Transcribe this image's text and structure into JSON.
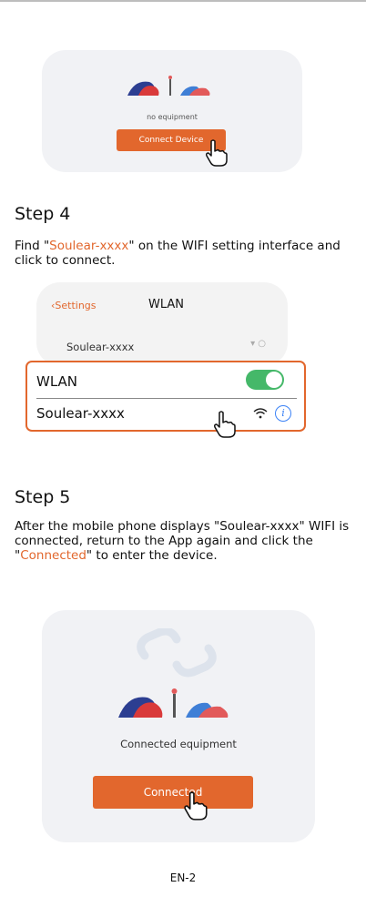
{
  "card1": {
    "no_equipment": "no equipment",
    "connect_button": "Connect Device"
  },
  "step4": {
    "title": "Step 4",
    "text": {
      "pre": "Find \"",
      "highlight": "Soulear-xxxx",
      "post": "\" on the WIFI setting interface and click to connect."
    }
  },
  "phone": {
    "back": "Settings",
    "title": "WLAN",
    "ssid": "Soulear-xxxx"
  },
  "wlan_box": {
    "wlan_label": "WLAN",
    "ssid_label": "Soulear-xxxx",
    "info": "i",
    "toggle_on": true
  },
  "step5": {
    "title": "Step 5",
    "text": {
      "pre": "After the mobile phone displays \"Soulear-xxxx\" WIFI is connected, return to the App again and click the \"",
      "highlight": "Connected",
      "post": "\" to enter the device."
    }
  },
  "card3": {
    "connected_equipment": "Connected equipment",
    "connected_button": "Connected"
  },
  "page_number": "EN-2",
  "colors": {
    "accent": "#e2672d",
    "toggle": "#45b869",
    "info": "#3b82f6"
  },
  "icons": [
    "hand-pointer-icon",
    "wifi-icon",
    "info-icon",
    "chevron-left-icon",
    "link-icon"
  ]
}
